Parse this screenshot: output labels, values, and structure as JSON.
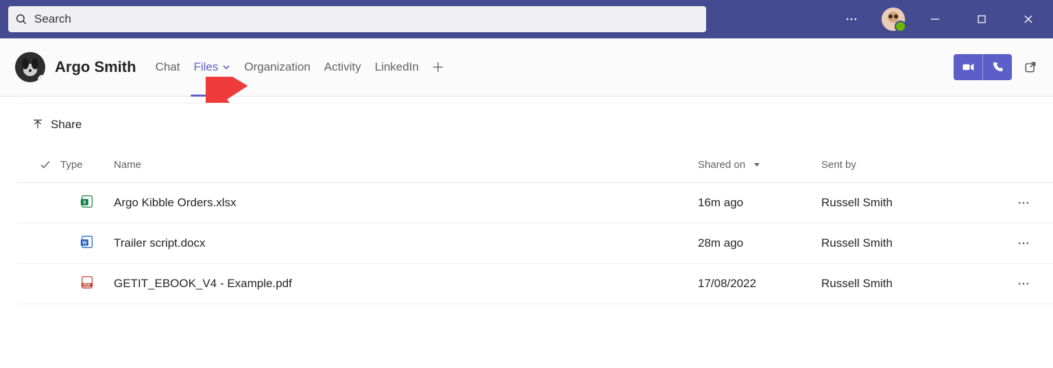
{
  "search": {
    "placeholder": "Search"
  },
  "contact": {
    "name": "Argo Smith"
  },
  "tabs": {
    "chat": "Chat",
    "files": "Files",
    "organization": "Organization",
    "activity": "Activity",
    "linkedin": "LinkedIn"
  },
  "share_button": "Share",
  "columns": {
    "type": "Type",
    "name": "Name",
    "shared_on": "Shared on",
    "sent_by": "Sent by"
  },
  "files": [
    {
      "type": "excel",
      "name": "Argo Kibble Orders.xlsx",
      "shared_on": "16m ago",
      "sent_by": "Russell Smith"
    },
    {
      "type": "word",
      "name": "Trailer script.docx",
      "shared_on": "28m ago",
      "sent_by": "Russell Smith"
    },
    {
      "type": "pdf",
      "name": "GETIT_EBOOK_V4 - Example.pdf",
      "shared_on": "17/08/2022",
      "sent_by": "Russell Smith"
    }
  ]
}
